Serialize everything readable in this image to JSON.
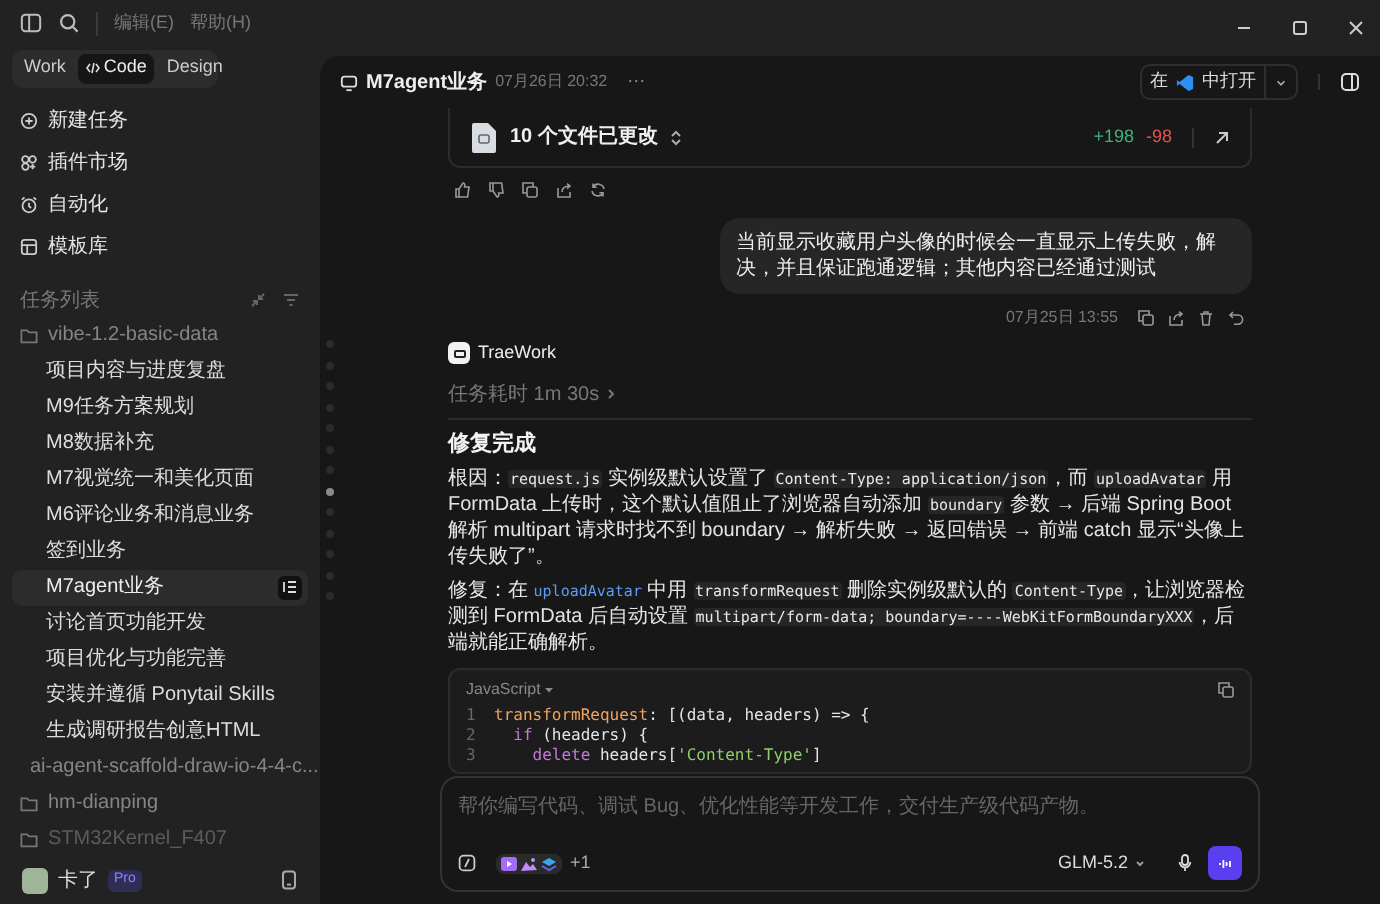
{
  "menu": [
    "编辑(E)",
    "帮助(H)"
  ],
  "modes": [
    {
      "label": "Work",
      "selected": false
    },
    {
      "label": "Code",
      "selected": true
    },
    {
      "label": "Design",
      "selected": false
    }
  ],
  "nav": [
    {
      "label": "新建任务"
    },
    {
      "label": "插件市场"
    },
    {
      "label": "自动化"
    },
    {
      "label": "模板库"
    }
  ],
  "task_list": {
    "title": "任务列表",
    "folders": [
      {
        "name": "vibe-1.2-basic-data",
        "expanded": true,
        "faded": false,
        "children": [
          {
            "label": "项目内容与进度复盘",
            "selected": false
          },
          {
            "label": "M9任务方案规划",
            "selected": false
          },
          {
            "label": "M8数据补充",
            "selected": false
          },
          {
            "label": "M7视觉统一和美化页面",
            "selected": false
          },
          {
            "label": "M6评论业务和消息业务",
            "selected": false
          },
          {
            "label": "签到业务",
            "selected": false
          },
          {
            "label": "M7agent业务",
            "selected": true
          },
          {
            "label": "讨论首页功能开发",
            "selected": false
          },
          {
            "label": "项目优化与功能完善",
            "selected": false
          },
          {
            "label": "安装并遵循 Ponytail Skills",
            "selected": false
          },
          {
            "label": "生成调研报告创意HTML",
            "selected": false
          }
        ]
      },
      {
        "name": "ai-agent-scaffold-draw-io-4-4-c...",
        "expanded": false,
        "faded": false
      },
      {
        "name": "hm-dianping",
        "expanded": false,
        "faded": false
      },
      {
        "name": "STM32Kernel_F407",
        "expanded": false,
        "faded": true
      }
    ]
  },
  "user": {
    "name": "卡了",
    "badge": "Pro"
  },
  "header": {
    "title": "M7agent业务",
    "time": "07月26日 20:32",
    "more": "···",
    "open_in": {
      "before": "在",
      "after": "中打开"
    }
  },
  "nav_dots": [
    {
      "selected": false
    },
    {
      "selected": false
    },
    {
      "selected": false
    },
    {
      "selected": false
    },
    {
      "selected": false
    },
    {
      "selected": false
    },
    {
      "selected": false
    },
    {
      "selected": true
    },
    {
      "selected": false
    },
    {
      "selected": false
    },
    {
      "selected": false
    },
    {
      "selected": false
    },
    {
      "selected": false
    }
  ],
  "changes": {
    "label": "10 个文件已更改",
    "added": "+198",
    "removed": "-98"
  },
  "user_message": {
    "text": "当前显示收藏用户头像的时候会一直显示上传失败，解决，并且保证跑通逻辑；其他内容已经通过测试",
    "time": "07月25日 13:55"
  },
  "assistant": {
    "name": "TraeWork",
    "duration": "任务耗时 1m 30s",
    "title": "修复完成",
    "paragraphs": [
      [
        {
          "kind": "text",
          "text": "根因："
        },
        {
          "kind": "code",
          "text": "request.js"
        },
        {
          "kind": "text",
          "text": " 实例级默认设置了 "
        },
        {
          "kind": "code",
          "text": "Content-Type: application/json"
        },
        {
          "kind": "text",
          "text": "，而 "
        },
        {
          "kind": "code",
          "text": "uploadAvatar"
        },
        {
          "kind": "text",
          "text": " 用 FormData 上传时，这个默认值阻止了浏览器自动添加 "
        },
        {
          "kind": "code",
          "text": "boundary"
        },
        {
          "kind": "text",
          "text": " 参数 → 后端 Spring Boot 解析 multipart 请求时找不到 boundary → 解析失败 → 返回错误 → 前端 catch 显示“头像上传失败了”。"
        }
      ],
      [
        {
          "kind": "text",
          "text": "修复：在 "
        },
        {
          "kind": "link",
          "text": "uploadAvatar"
        },
        {
          "kind": "text",
          "text": " 中用 "
        },
        {
          "kind": "code",
          "text": "transformRequest"
        },
        {
          "kind": "text",
          "text": " 删除实例级默认的 "
        },
        {
          "kind": "code",
          "text": "Content-Type"
        },
        {
          "kind": "text",
          "text": "，让浏览器检测到 FormData 后自动设置 "
        },
        {
          "kind": "code",
          "text": "multipart/form-data; boundary=----WebKitFormBoundaryXXX"
        },
        {
          "kind": "text",
          "text": "，后端就能正确解析。"
        }
      ]
    ],
    "code": {
      "language": "JavaScript",
      "lines": [
        {
          "number": "1",
          "tokens": [
            {
              "kind": "prop",
              "text": "transformRequest"
            },
            {
              "kind": "plain",
              "text": ": [(data, headers) => {"
            }
          ]
        },
        {
          "number": "2",
          "tokens": [
            {
              "kind": "keyword",
              "text": "  if"
            },
            {
              "kind": "plain",
              "text": " (headers) {"
            }
          ]
        },
        {
          "number": "3",
          "tokens": [
            {
              "kind": "keyword",
              "text": "    delete"
            },
            {
              "kind": "plain",
              "text": " headers["
            },
            {
              "kind": "string",
              "text": "'Content-Type'"
            },
            {
              "kind": "plain",
              "text": "]"
            }
          ]
        }
      ]
    }
  },
  "composer": {
    "placeholder": "帮你编写代码、调试 Bug、优化性能等开发工作，交付生产级代码产物。",
    "more_skills": "+1",
    "model": "GLM-5.2"
  }
}
